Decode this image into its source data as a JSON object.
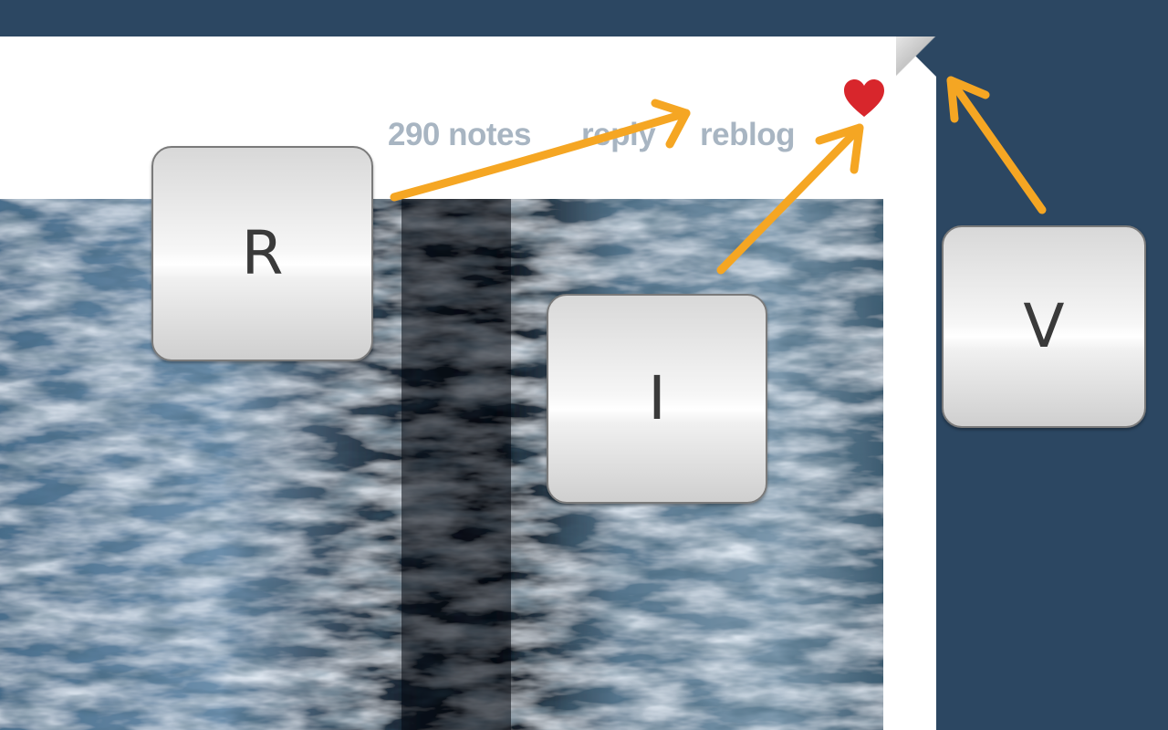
{
  "post": {
    "notes_label": "290 notes",
    "reply_label": "reply",
    "reblog_label": "reblog",
    "like_icon": "heart-icon",
    "photo_subject": "waterfall"
  },
  "shortcuts": {
    "reblog_key": "R",
    "like_key": "I",
    "next_key": "V"
  },
  "colors": {
    "background": "#2c4762",
    "card": "#ffffff",
    "footer_text": "#a8b5c2",
    "heart": "#d8262c",
    "arrow": "#f5a623"
  }
}
